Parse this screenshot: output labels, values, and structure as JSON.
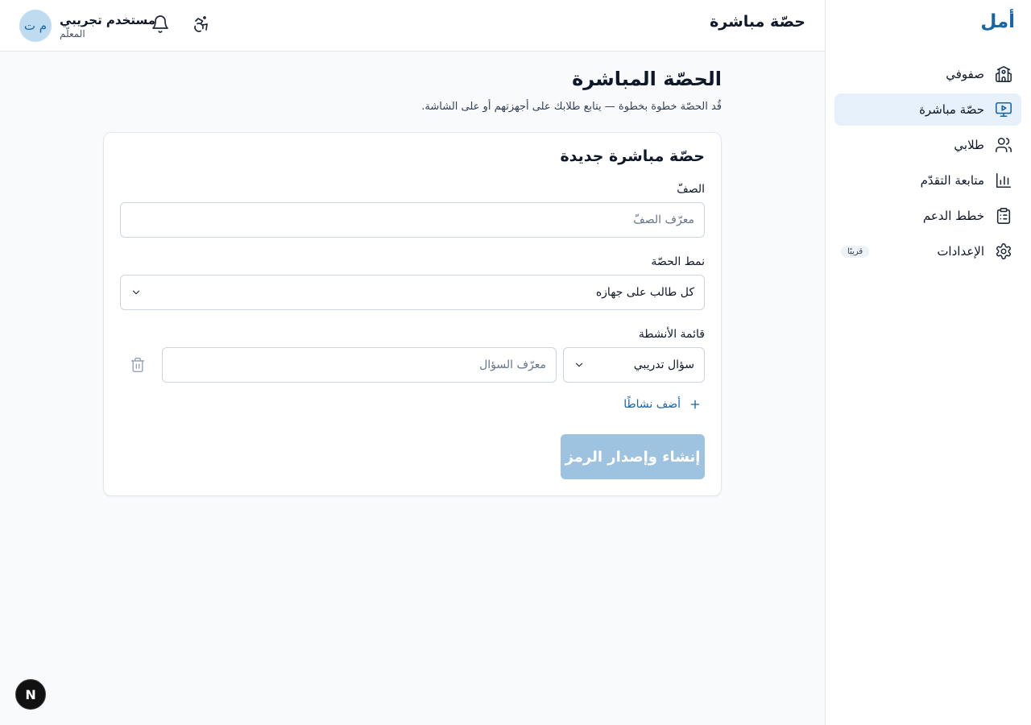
{
  "app": {
    "brand": "أمل"
  },
  "sidebar": {
    "items": [
      {
        "label": "صفوفي",
        "icon": "school-icon"
      },
      {
        "label": "حصّة مباشرة",
        "icon": "presentation-icon",
        "active": true
      },
      {
        "label": "طلابي",
        "icon": "users-icon"
      },
      {
        "label": "متابعة التقدّم",
        "icon": "bar-chart-icon"
      },
      {
        "label": "خطط الدعم",
        "icon": "clipboard-list-icon"
      },
      {
        "label": "الإعدادات",
        "icon": "gear-icon",
        "badge": "قريبًا"
      }
    ]
  },
  "header": {
    "title": "حصّة مباشرة",
    "user_name": "مستخدم تجريبي",
    "user_role": "المعلّم",
    "avatar_initials": "م ت"
  },
  "main": {
    "title": "الحصّة المباشرة",
    "subtitle": "قُد الحصّة خطوة بخطوة — يتابع طلابك على أجهزتهم أو على الشاشة.",
    "card": {
      "title": "حصّة مباشرة جديدة",
      "class_label": "الصفّ",
      "class_placeholder": "معرّف الصفّ",
      "class_value": "",
      "mode_label": "نمط الحصّة",
      "mode_value": "كل طالب على جهازه",
      "activities_label": "قائمة الأنشطة",
      "activity_type_value": "سؤال تدريبي",
      "question_placeholder": "معرّف السؤال",
      "question_value": "",
      "add_activity_label": "أضف نشاطًا",
      "submit_label": "إنشاء وإصدار الرمز"
    }
  },
  "fab": {
    "label": "N"
  },
  "colors": {
    "accent": "#1565a8",
    "active_nav_bg": "#e6f1fb",
    "submit_disabled": "#9ec3e0",
    "page_bg": "#f8fafc"
  }
}
